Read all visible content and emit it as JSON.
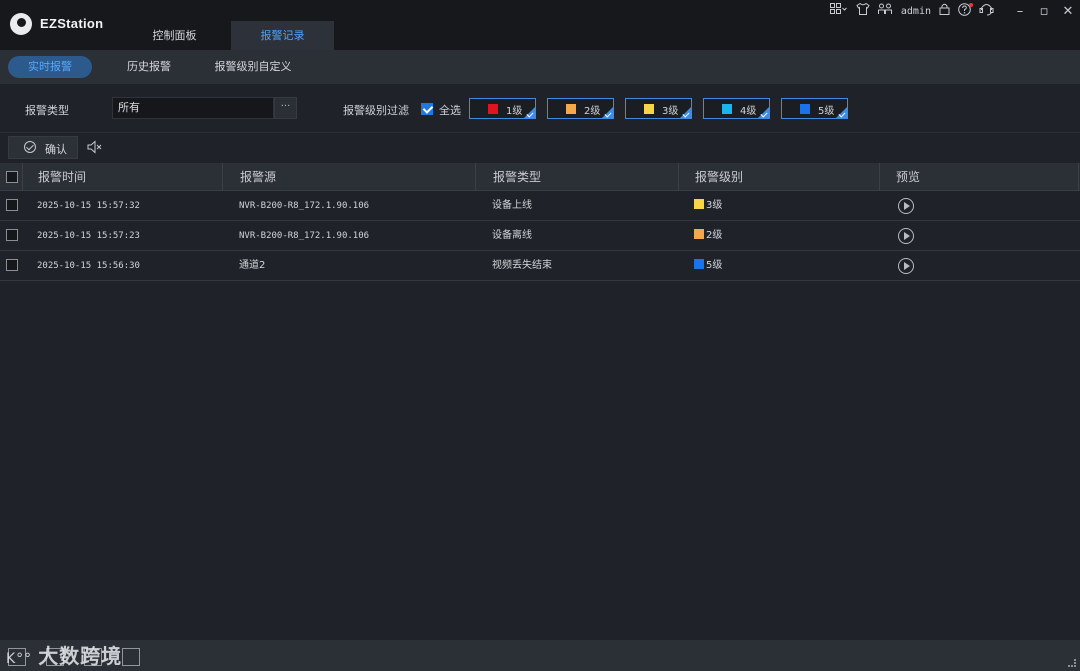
{
  "app": {
    "title": "EZStation"
  },
  "main_tabs": [
    {
      "label": "控制面板",
      "active": false
    },
    {
      "label": "报警记录",
      "active": true
    }
  ],
  "system": {
    "user": "admin"
  },
  "sub_tabs": [
    {
      "label": "实时报警",
      "active": true
    },
    {
      "label": "历史报警",
      "active": false
    },
    {
      "label": "报警级别自定义",
      "active": false
    }
  ],
  "filter": {
    "type_label": "报警类型",
    "type_value": "所有",
    "type_more": "···",
    "level_filter_label": "报警级别过滤",
    "select_all_label": "全选",
    "select_all_checked": true,
    "levels": [
      {
        "label": "1级",
        "color": "#e0141e",
        "selected": true
      },
      {
        "label": "2级",
        "color": "#f5a84a",
        "selected": true
      },
      {
        "label": "3级",
        "color": "#f7d547",
        "selected": true
      },
      {
        "label": "4级",
        "color": "#19b6ee",
        "selected": true
      },
      {
        "label": "5级",
        "color": "#1a73e8",
        "selected": true
      }
    ]
  },
  "toolbar": {
    "confirm_label": "确认"
  },
  "table": {
    "columns": [
      "报警时间",
      "报警源",
      "报警类型",
      "报警级别",
      "预览"
    ],
    "rows": [
      {
        "time": "2025-10-15 15:57:32",
        "source": "NVR-B200-R8_172.1.90.106",
        "type": "设备上线",
        "level": "3级",
        "level_color": "#f7d547"
      },
      {
        "time": "2025-10-15 15:57:23",
        "source": "NVR-B200-R8_172.1.90.106",
        "type": "设备离线",
        "level": "2级",
        "level_color": "#f5a84a"
      },
      {
        "time": "2025-10-15 15:56:30",
        "source": "通道2",
        "type": "视频丢失结束",
        "level": "5级",
        "level_color": "#1a73e8"
      }
    ]
  },
  "watermark": "大数跨境"
}
